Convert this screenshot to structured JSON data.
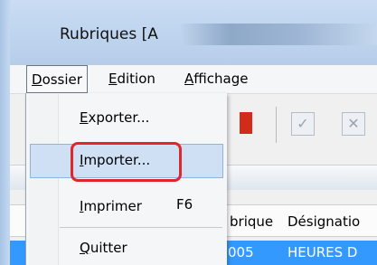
{
  "window": {
    "title": "Rubriques [A"
  },
  "menubar": {
    "items": [
      {
        "label": "Dossier",
        "mnemonic": "D",
        "rest": "ossier"
      },
      {
        "label": "Edition",
        "mnemonic": "E",
        "rest": "dition"
      },
      {
        "label": "Affichage",
        "mnemonic": "A",
        "rest": "ffichage"
      }
    ]
  },
  "dossier_menu": {
    "items": [
      {
        "label": "Exporter...",
        "mnemonic": "E",
        "rest": "xporter..."
      },
      {
        "label": "Importer...",
        "mnemonic": "I",
        "rest": "mporter..."
      },
      {
        "label": "Imprimer",
        "mnemonic": "I",
        "rest": "mprimer",
        "shortcut": "F6"
      },
      {
        "label": "Quitter",
        "mnemonic": "Q",
        "rest": "uitter"
      }
    ]
  },
  "toolbar": {
    "check_icon": "check-icon",
    "close_icon": "close-icon"
  },
  "table": {
    "headers": [
      "brique",
      "Désignatio"
    ],
    "row": [
      "005",
      "HEURES D"
    ]
  },
  "colors": {
    "accent": "#3399ff",
    "highlight_ring": "#e0262a",
    "menu_hover": "#cfe0f5"
  }
}
